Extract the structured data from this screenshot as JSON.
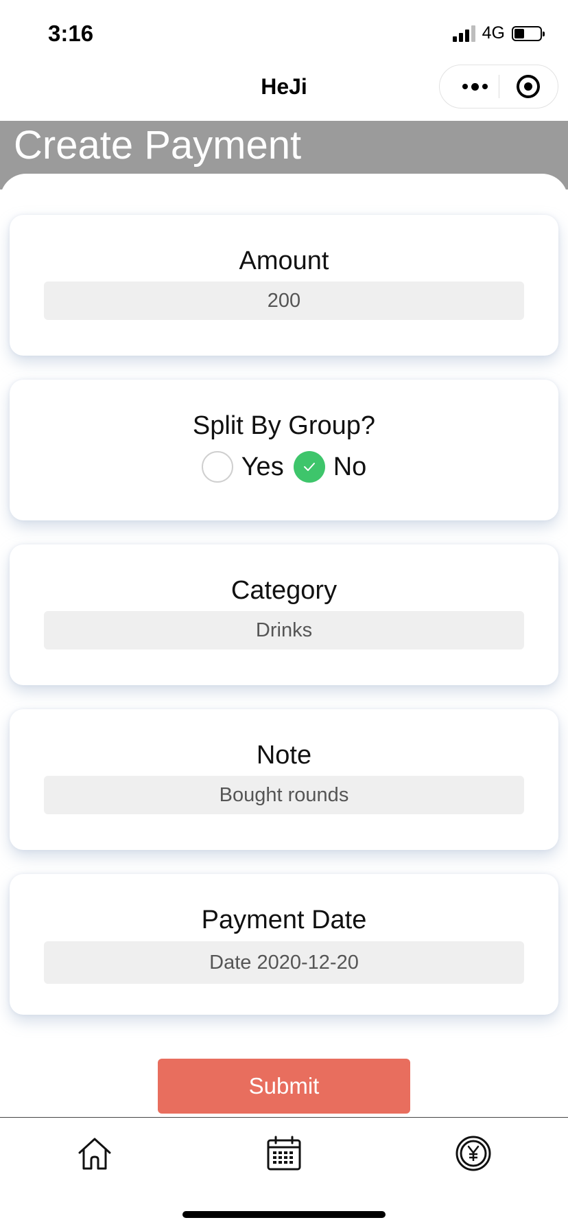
{
  "status_bar": {
    "time": "3:16",
    "network": "4G"
  },
  "nav": {
    "title": "HeJi",
    "more_icon": "more-dots-icon",
    "close_icon": "target-icon"
  },
  "page": {
    "title": "Create Payment"
  },
  "form": {
    "amount": {
      "label": "Amount",
      "value": "200"
    },
    "split": {
      "label": "Split By Group?",
      "options": [
        {
          "label": "Yes",
          "selected": false
        },
        {
          "label": "No",
          "selected": true
        }
      ]
    },
    "category": {
      "label": "Category",
      "value": "Drinks"
    },
    "note": {
      "label": "Note",
      "value": "Bought rounds"
    },
    "payment_date": {
      "label": "Payment Date",
      "value": "Date 2020-12-20"
    },
    "submit_label": "Submit"
  },
  "tab_bar": {
    "items": [
      {
        "icon": "home-icon"
      },
      {
        "icon": "calendar-icon"
      },
      {
        "icon": "yen-coin-icon"
      }
    ]
  },
  "colors": {
    "header_band": "#9b9b9b",
    "submit": "#e86e5e",
    "radio_selected": "#3ec56b",
    "field_bg": "#efefef"
  }
}
